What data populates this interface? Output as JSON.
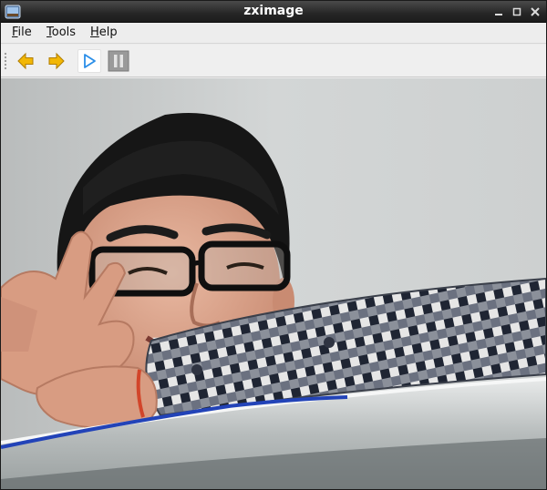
{
  "window": {
    "title": "zximage"
  },
  "menu": {
    "items": [
      {
        "label": "File"
      },
      {
        "label": "Tools"
      },
      {
        "label": "Help"
      }
    ]
  },
  "toolbar": {
    "buttons": [
      {
        "icon": "arrow-left-icon",
        "color": "#f0b400"
      },
      {
        "icon": "arrow-right-icon",
        "color": "#f0b400"
      },
      {
        "icon": "play-icon",
        "color": "#2a8ee8"
      },
      {
        "icon": "pause-icon",
        "color": "#8f8f8f"
      }
    ]
  },
  "image": {
    "content": "webcam photo"
  }
}
